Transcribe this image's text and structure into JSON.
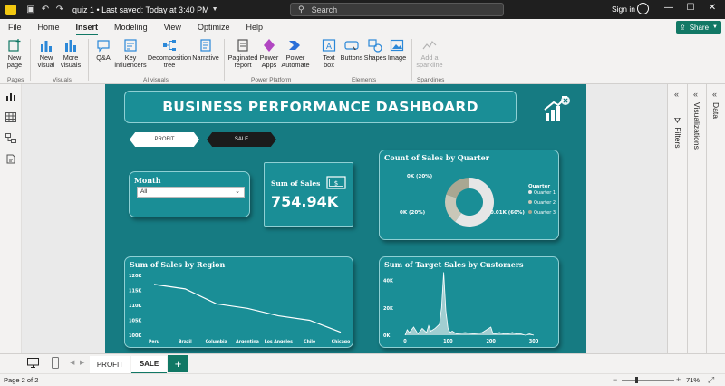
{
  "titlebar": {
    "doc_title": "quiz 1 • Last saved: Today at 3:40 PM",
    "search_placeholder": "Search",
    "sign_in": "Sign in"
  },
  "menu": {
    "items": [
      "File",
      "Home",
      "Insert",
      "Modeling",
      "View",
      "Optimize",
      "Help"
    ],
    "active": "Insert",
    "share": "Share"
  },
  "ribbon": {
    "buttons": {
      "new_page": "New page",
      "new_visual": "New visual",
      "more_visuals": "More visuals",
      "qa": "Q&A",
      "key_influencers": "Key influencers",
      "decomposition_tree": "Decomposition tree",
      "narrative": "Narrative",
      "paginated_report": "Paginated report",
      "power_apps": "Power Apps",
      "power_automate": "Power Automate",
      "text_box": "Text box",
      "buttons": "Buttons",
      "shapes": "Shapes",
      "image": "Image",
      "add_sparkline": "Add a sparkline"
    },
    "groups": {
      "pages": "Pages",
      "visuals": "Visuals",
      "ai_visuals": "AI visuals",
      "power_platform": "Power Platform",
      "elements": "Elements",
      "sparklines": "Sparklines"
    }
  },
  "report": {
    "title": "BUSINESS PERFORMANCE  DASHBOARD",
    "nav": {
      "profit": "PROFIT",
      "sale": "SALE"
    },
    "slicer": {
      "label": "Month",
      "value": "All"
    },
    "kpi": {
      "title": "Sum of Sales",
      "value": "754.94K"
    }
  },
  "chart_data": [
    {
      "type": "pie",
      "title": "Count of Sales by Quarter",
      "legend_title": "Quarter",
      "legend_position": "right",
      "slices": [
        {
          "name": "Quarter 1",
          "value": 60,
          "label": "0.01K (60%)",
          "color": "#e6e6e6"
        },
        {
          "name": "Quarter 2",
          "value": 20,
          "label": "0K (20%)",
          "color": "#c9c7b8"
        },
        {
          "name": "Quarter 3",
          "value": 20,
          "label": "0K (20%)",
          "color": "#a9a792"
        }
      ]
    },
    {
      "type": "line",
      "title": "Sum of Sales by Region",
      "categories": [
        "Peru",
        "Brazil",
        "Columbia",
        "Argentina",
        "Los Angeles",
        "Chile",
        "Chicago"
      ],
      "values": [
        117,
        115.5,
        110.5,
        109,
        106.5,
        105,
        101
      ],
      "y_ticks": [
        "120K",
        "115K",
        "110K",
        "105K",
        "100K"
      ],
      "ylim": [
        100,
        120
      ],
      "color": "#ffffff"
    },
    {
      "type": "area",
      "title": "Sum of Target Sales by Customers",
      "x_ticks": [
        "0",
        "100",
        "200",
        "300"
      ],
      "y_ticks": [
        "40K",
        "20K",
        "0K"
      ],
      "xlim": [
        0,
        300
      ],
      "ylim": [
        0,
        45
      ],
      "x": [
        0,
        5,
        10,
        20,
        30,
        40,
        50,
        55,
        60,
        70,
        80,
        85,
        90,
        95,
        100,
        105,
        110,
        120,
        140,
        160,
        180,
        200,
        205,
        210,
        220,
        230,
        240,
        250,
        260,
        270,
        280,
        290,
        300
      ],
      "values": [
        0,
        4,
        2,
        6,
        1,
        5,
        2,
        7,
        3,
        5,
        8,
        20,
        46,
        18,
        5,
        2,
        3,
        1,
        2,
        1,
        2,
        6,
        1,
        1,
        2,
        1,
        1,
        2,
        1,
        1,
        0,
        1,
        0
      ],
      "color": "#cfe3e4"
    }
  ],
  "tabs": {
    "profit": "PROFIT",
    "sale": "SALE",
    "add": "+"
  },
  "panes": {
    "filters": "Filters",
    "visualizations": "Visualizations",
    "data": "Data"
  },
  "status": {
    "page": "Page 2 of 2",
    "zoom": "71%"
  }
}
